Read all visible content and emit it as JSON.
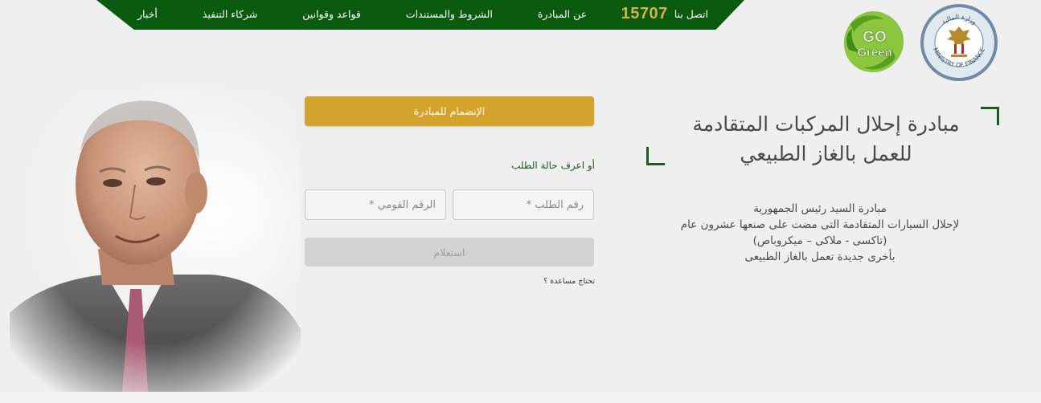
{
  "nav": {
    "items": [
      {
        "label": "عن المبادرة"
      },
      {
        "label": "الشروط والمستندات"
      },
      {
        "label": "قواعد وقوانين"
      },
      {
        "label": "شركاء التنفيذ"
      },
      {
        "label": "أخبار"
      }
    ],
    "contact_label": "اتصل بنا",
    "hotline": "15707"
  },
  "logos": {
    "ministry_text": "MINISTRY OF FINANCE",
    "ministry_arabic": "وزارة المالية",
    "green_line1": "GO",
    "green_line2": "Green"
  },
  "form": {
    "join_label": "الإنضمام للمبادرة",
    "status_link": "أو اعرف حالة الطلب",
    "order_placeholder": "رقم الطلب *",
    "national_id_placeholder": "الرقم القومي *",
    "inquire_label": "استعلام",
    "help_link": "تحتاج مساعدة ؟"
  },
  "hero": {
    "title_line1": "مبادرة إحلال المركبات المتقادمة",
    "title_line2": "للعمل بالغاز الطبيعي",
    "description": [
      "مبادرة السيد رئيس الجمهورية",
      "لإحلال السيارات المتقادمة التى مضت على صنعها عشرون عام",
      "(تاكسى - ملاكى – ميكروباص)",
      "بأخرى جديدة تعمل بالغاز الطبيعى"
    ]
  },
  "colors": {
    "nav_green": "#0a5a10",
    "gold": "#d4a32c",
    "hotline_gold": "#d4b33a"
  }
}
